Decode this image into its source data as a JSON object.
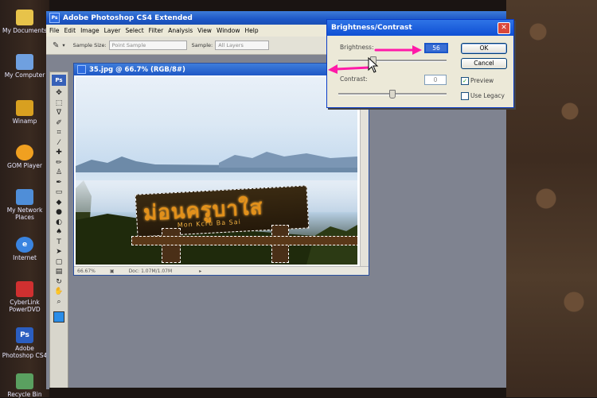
{
  "desktop": {
    "icons": [
      {
        "label": "My Documents",
        "icon": "folder-icon",
        "color": "#e7c34a"
      },
      {
        "label": "My Computer",
        "icon": "computer-icon",
        "color": "#6fa0e0"
      },
      {
        "label": "Winamp",
        "icon": "winamp-icon",
        "color": "#d8a020"
      },
      {
        "label": "GOM Player",
        "icon": "gom-player-icon",
        "color": "#f0a020"
      },
      {
        "label": "My Network Places",
        "icon": "network-icon",
        "color": "#4f8ed8"
      },
      {
        "label": "Internet",
        "icon": "ie-icon",
        "color": "#3a84e0"
      },
      {
        "label": "CyberLink PowerDVD",
        "icon": "powerdvd-icon",
        "color": "#d03030"
      },
      {
        "label": "Adobe Photoshop CS4",
        "icon": "photoshop-icon",
        "color": "#2b5ec0"
      },
      {
        "label": "Recycle Bin",
        "icon": "recycle-bin-icon",
        "color": "#5aa060"
      }
    ]
  },
  "app": {
    "title": "Adobe Photoshop CS4 Extended",
    "menu": [
      "File",
      "Edit",
      "Image",
      "Layer",
      "Select",
      "Filter",
      "Analysis",
      "View",
      "Window",
      "Help"
    ],
    "options": {
      "sample_size_label": "Sample Size:",
      "sample_size_value": "Point Sample",
      "sample_label": "Sample:",
      "sample_value": "All Layers"
    },
    "tools_logo": "Ps"
  },
  "document": {
    "title": "35.jpg @ 66.7% (RGB/8#)",
    "zoom": "66.67%",
    "doc_info": "Doc: 1.07M/1.07M",
    "sign_thai": "ม่อนครูบาใส",
    "sign_latin": "Mon  Kcru  Ba  Sai"
  },
  "dialog": {
    "title": "Brightness/Contrast",
    "brightness_label": "Brightness:",
    "brightness_value": "56",
    "contrast_label": "Contrast:",
    "contrast_value": "0",
    "ok_label": "OK",
    "cancel_label": "Cancel",
    "preview_label": "Preview",
    "preview_checked": true,
    "legacy_label": "Use Legacy",
    "legacy_checked": false,
    "annotation_color": "#ff1aa8"
  }
}
